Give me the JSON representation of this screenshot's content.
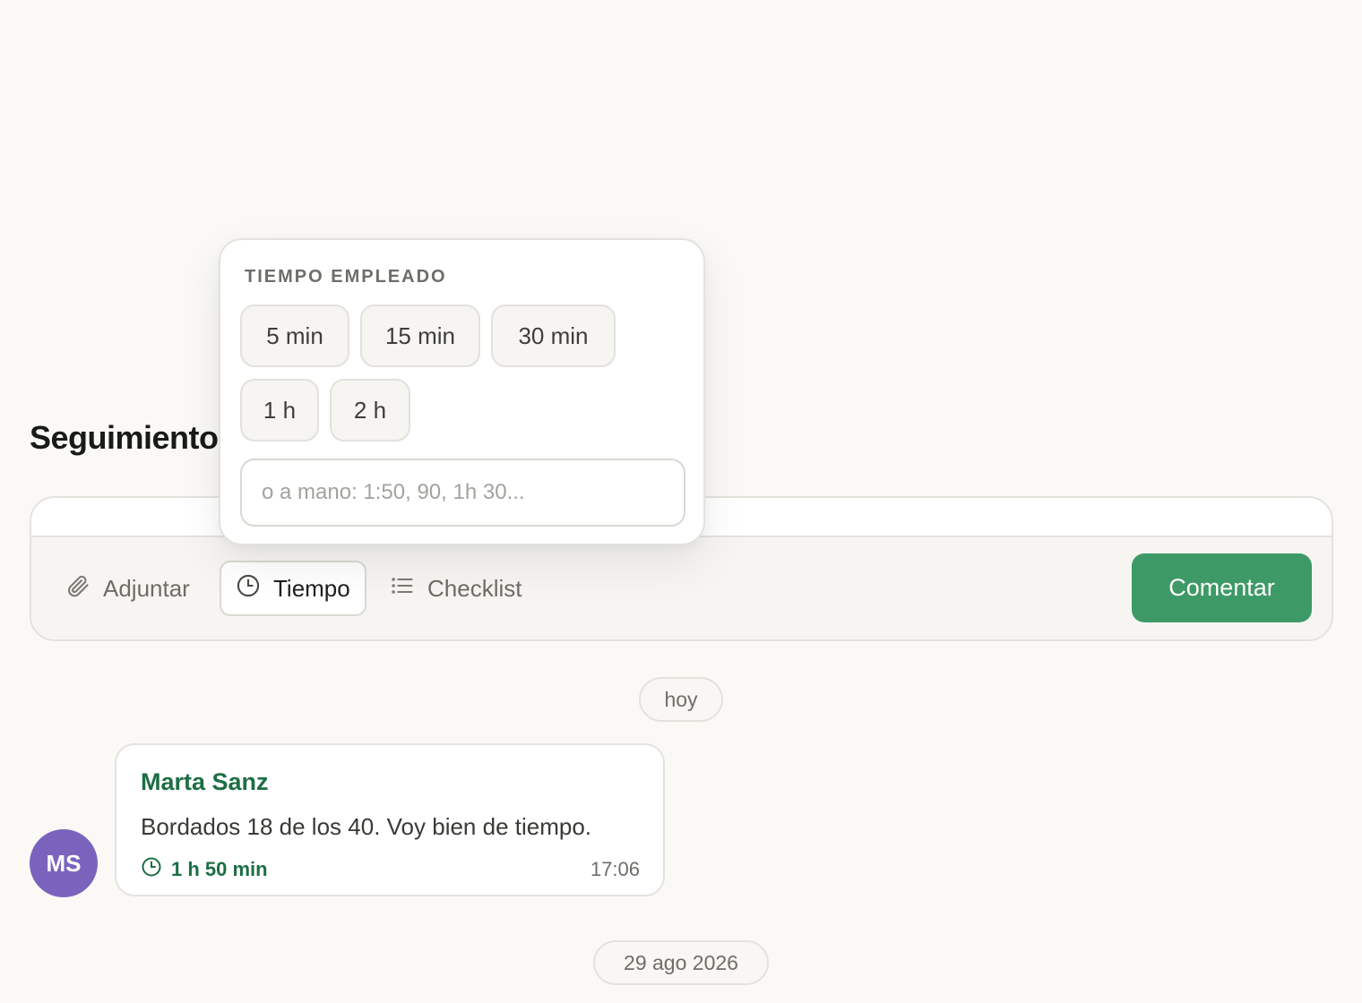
{
  "section": {
    "title": "Seguimiento"
  },
  "popover": {
    "title": "TIEMPO EMPLEADO",
    "options": [
      "5 min",
      "15 min",
      "30 min",
      "1 h",
      "2 h"
    ],
    "manual_placeholder": "o a mano: 1:50, 90, 1h 30..."
  },
  "toolbar": {
    "attach_label": "Adjuntar",
    "time_label": "Tiempo",
    "checklist_label": "Checklist",
    "comment_label": "Comentar"
  },
  "feed": {
    "today_label": "hoy",
    "message": {
      "avatar_initials": "MS",
      "author": "Marta Sanz",
      "text": "Bordados 18 de los 40. Voy bien de tiempo.",
      "time_spent": "1 h 50 min",
      "time": "17:06"
    },
    "older_date_label": "29 ago 2026"
  },
  "colors": {
    "accent": "#3d9a66",
    "author": "#1c6e44",
    "avatar": "#7a63bd"
  },
  "icons": {
    "attach": "paperclip-icon",
    "time": "clock-icon",
    "checklist": "list-icon"
  }
}
